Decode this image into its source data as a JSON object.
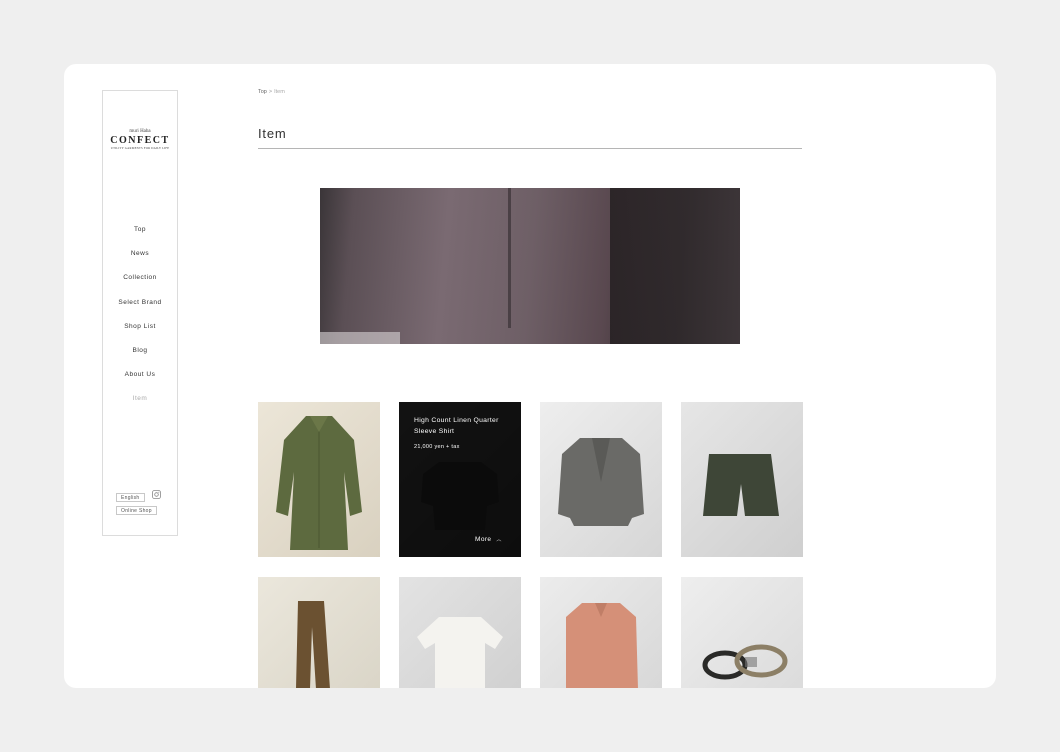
{
  "logo": {
    "small": "muri Haba",
    "main": "CONFECT",
    "tagline": "UTILITY GARMENTS FOR DAILY LIFE"
  },
  "nav": [
    {
      "label": "Top"
    },
    {
      "label": "News"
    },
    {
      "label": "Collection"
    },
    {
      "label": "Select Brand"
    },
    {
      "label": "Shop List"
    },
    {
      "label": "Blog"
    },
    {
      "label": "About Us"
    },
    {
      "label": "Item"
    }
  ],
  "sidebar_bottom": {
    "english_label": "English",
    "instagram_icon": "instagram-icon",
    "online_shop_label": "Online Shop"
  },
  "breadcrumb": {
    "home": "Top",
    "separator": ">",
    "current": "Item"
  },
  "page_title": "Item",
  "featured_item": {
    "name": "High Count Linen Quarter Sleeve Shirt",
    "price": "21,000 yen + tax",
    "more_label": "More",
    "more_icon": "chevron-up-icon"
  },
  "items": [
    {
      "garment": "olive coat"
    },
    {
      "garment": "black linen shirt"
    },
    {
      "garment": "grey jacket"
    },
    {
      "garment": "dark green shorts"
    },
    {
      "garment": "brown trousers"
    },
    {
      "garment": "white t-shirt"
    },
    {
      "garment": "pink shirt"
    },
    {
      "garment": "belts"
    }
  ],
  "colors": {
    "background": "#efefef",
    "panel": "#ffffff",
    "overlay": "#0a0a0a",
    "text": "#333333",
    "muted": "#aaaaaa"
  }
}
